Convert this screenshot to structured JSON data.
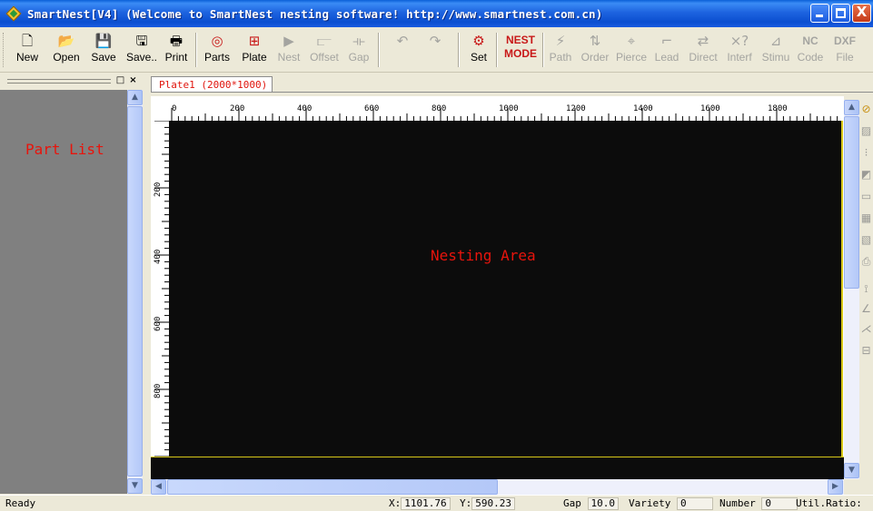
{
  "window": {
    "title": "SmartNest[V4] (Welcome to SmartNest nesting software!  http://www.smartnest.com.cn)",
    "controls": {
      "minimize": "_",
      "maximize": "□",
      "close": "X"
    }
  },
  "toolbar": {
    "items": [
      {
        "label": "New",
        "icon": "🗋",
        "icon_name": "new-document-icon",
        "enabled": true
      },
      {
        "label": "Open",
        "icon": "📂",
        "icon_name": "open-folder-icon",
        "enabled": true
      },
      {
        "label": "Save",
        "icon": "💾",
        "icon_name": "save-disk-icon",
        "enabled": true
      },
      {
        "label": "Save..",
        "icon": "🖫",
        "icon_name": "save-as-icon",
        "enabled": true
      },
      {
        "label": "Print",
        "icon": "🖶",
        "icon_name": "printer-icon",
        "enabled": true
      },
      {
        "label": "Parts",
        "icon": "◎",
        "icon_name": "parts-icon",
        "enabled": true
      },
      {
        "label": "Plate",
        "icon": "⊞",
        "icon_name": "plate-icon",
        "enabled": true
      },
      {
        "label": "Nest",
        "icon": "▶",
        "icon_name": "nest-play-icon",
        "enabled": false
      },
      {
        "label": "Offset",
        "icon": "⫍",
        "icon_name": "offset-icon",
        "enabled": false
      },
      {
        "label": "Gap",
        "icon": "⟛",
        "icon_name": "gap-icon",
        "enabled": false
      },
      {
        "label": "",
        "icon": "↶",
        "icon_name": "undo-icon",
        "enabled": false
      },
      {
        "label": "",
        "icon": "↷",
        "icon_name": "redo-icon",
        "enabled": false
      },
      {
        "label": "Set",
        "icon": "⚙",
        "icon_name": "settings-wrench-icon",
        "enabled": true
      },
      {
        "label": "NEST\nMODE",
        "icon": "",
        "icon_name": "nest-mode-label",
        "enabled": true
      },
      {
        "label": "Path",
        "icon": "⚡",
        "icon_name": "path-icon",
        "enabled": false
      },
      {
        "label": "Order",
        "icon": "⇅",
        "icon_name": "order-icon",
        "enabled": false
      },
      {
        "label": "Pierce",
        "icon": "⌖",
        "icon_name": "pierce-icon",
        "enabled": false
      },
      {
        "label": "Lead",
        "icon": "⌐",
        "icon_name": "lead-icon",
        "enabled": false
      },
      {
        "label": "Direct",
        "icon": "⇄",
        "icon_name": "direction-icon",
        "enabled": false
      },
      {
        "label": "Interf",
        "icon": "×?",
        "icon_name": "interference-icon",
        "enabled": false
      },
      {
        "label": "Stimu",
        "icon": "⊿",
        "icon_name": "simulate-icon",
        "enabled": false
      },
      {
        "label": "Code",
        "icon": "NC",
        "icon_name": "nc-code-icon",
        "enabled": false
      },
      {
        "label": "File",
        "icon": "DXF",
        "icon_name": "dxf-file-icon",
        "enabled": false
      }
    ]
  },
  "part_list": {
    "title": "Part List",
    "dock_buttons": {
      "restore": "□",
      "close": "×"
    }
  },
  "tabs": [
    {
      "label": "Plate1 (2000*1000)"
    }
  ],
  "nesting": {
    "title": "Nesting Area",
    "ruler_x_labels": [
      "0",
      "200",
      "400",
      "600",
      "800",
      "1000",
      "1200",
      "1400",
      "1600",
      "1800"
    ],
    "ruler_y_labels": [
      "200",
      "400",
      "600",
      "800"
    ]
  },
  "status": {
    "ready": "Ready",
    "x_label": "X:",
    "x_value": "1101.76",
    "y_label": "Y:",
    "y_value": "590.23",
    "gap_label": "Gap",
    "gap_value": "10.0",
    "variety_label": "Variety",
    "variety_value": "0",
    "number_label": "Number",
    "number_value": "0",
    "util_label": "Util.Ratio:"
  },
  "scroll_arrows": {
    "up": "▲",
    "down": "▼",
    "left": "◀",
    "right": "▶"
  },
  "right_tools": [
    {
      "icon": "⊘",
      "name": "tool-select-icon"
    },
    {
      "icon": "▨",
      "name": "tool-fill-icon"
    },
    {
      "icon": "⁝",
      "name": "tool-number-icon"
    },
    {
      "icon": "◩",
      "name": "tool-part-icon"
    },
    {
      "icon": "▭",
      "name": "tool-rect-icon"
    },
    {
      "icon": "▦",
      "name": "tool-grid-icon"
    },
    {
      "icon": "▧",
      "name": "tool-hatch-icon"
    },
    {
      "icon": "⎙",
      "name": "tool-print-icon"
    },
    {
      "icon": "⟟",
      "name": "tool-measure-icon"
    },
    {
      "icon": "∠",
      "name": "tool-angle-icon"
    },
    {
      "icon": "⋌",
      "name": "tool-line-icon"
    },
    {
      "icon": "⊟",
      "name": "tool-layout-icon"
    }
  ]
}
